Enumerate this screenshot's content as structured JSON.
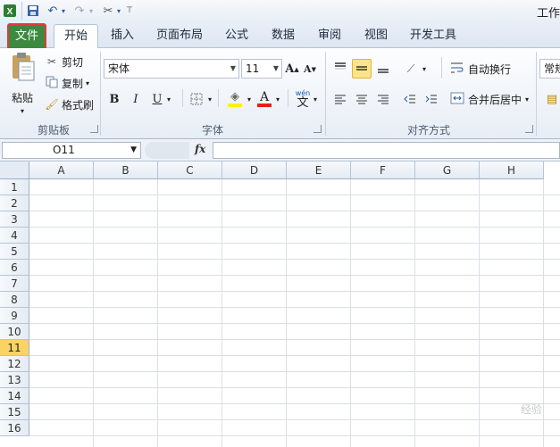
{
  "app": {
    "title": "工作"
  },
  "quick_access": {
    "excel_icon": "excel-logo",
    "save_icon": "save",
    "undo_icon": "undo",
    "redo_icon": "redo",
    "customize_icon": "tools"
  },
  "tabs": [
    {
      "label": "文件"
    },
    {
      "label": "开始"
    },
    {
      "label": "插入"
    },
    {
      "label": "页面布局"
    },
    {
      "label": "公式"
    },
    {
      "label": "数据"
    },
    {
      "label": "审阅"
    },
    {
      "label": "视图"
    },
    {
      "label": "开发工具"
    }
  ],
  "ribbon": {
    "clipboard": {
      "paste": "粘贴",
      "cut": "剪切",
      "copy": "复制",
      "format_painter": "格式刷",
      "group": "剪贴板"
    },
    "font": {
      "font_name": "宋体",
      "font_size": "11",
      "grow": "A",
      "shrink": "A",
      "bold": "B",
      "italic": "I",
      "underline": "U",
      "font_color_letter": "A",
      "phonetic": "wén",
      "phonetic_char": "文",
      "group": "字体"
    },
    "alignment": {
      "wrap_text": "自动换行",
      "merge_center": "合并后居中",
      "group": "对齐方式"
    },
    "number": {
      "format": "常规"
    }
  },
  "formula_bar": {
    "name_box": "O11",
    "fx_label": "fx",
    "formula": ""
  },
  "sheet": {
    "columns": [
      "A",
      "B",
      "C",
      "D",
      "E",
      "F",
      "G",
      "H"
    ],
    "rows": [
      "1",
      "2",
      "3",
      "4",
      "5",
      "6",
      "7",
      "8",
      "9",
      "10",
      "11",
      "12",
      "13",
      "14",
      "15",
      "16"
    ],
    "active_row": "11"
  },
  "watermark": "经验"
}
